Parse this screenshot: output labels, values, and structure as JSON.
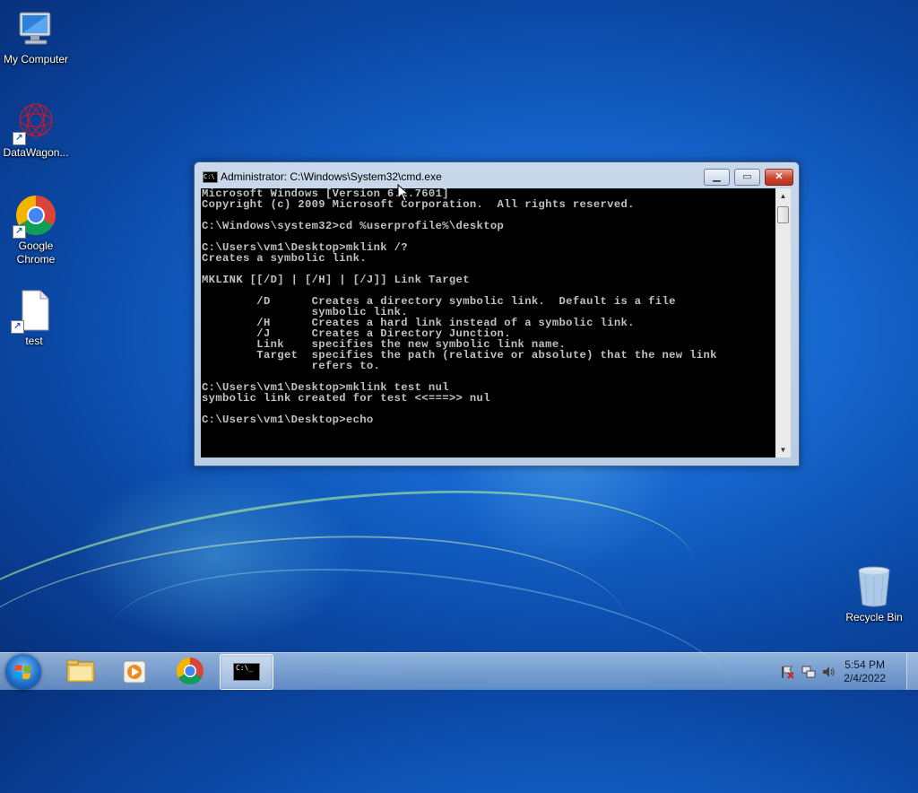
{
  "desktop": {
    "icons": [
      {
        "label": "My Computer",
        "icon": "computer-icon"
      },
      {
        "label": "DataWagon...",
        "icon": "datawagon-icon"
      },
      {
        "label": "Google Chrome",
        "icon": "chrome-icon"
      },
      {
        "label": "test",
        "icon": "file-icon"
      },
      {
        "label": "Recycle Bin",
        "icon": "recycle-bin-icon"
      }
    ]
  },
  "window": {
    "title": "Administrator: C:\\Windows\\System32\\cmd.exe",
    "icon_label": "C:\\",
    "buttons": {
      "minimize": "minimize-icon",
      "maximize": "maximize-icon",
      "close": "close-icon"
    }
  },
  "console": {
    "lines": "Microsoft Windows [Version 6.1.7601]\nCopyright (c) 2009 Microsoft Corporation.  All rights reserved.\n\nC:\\Windows\\system32>cd %userprofile%\\desktop\n\nC:\\Users\\vm1\\Desktop>mklink /?\nCreates a symbolic link.\n\nMKLINK [[/D] | [/H] | [/J]] Link Target\n\n        /D      Creates a directory symbolic link.  Default is a file\n                symbolic link.\n        /H      Creates a hard link instead of a symbolic link.\n        /J      Creates a Directory Junction.\n        Link    specifies the new symbolic link name.\n        Target  specifies the path (relative or absolute) that the new link\n                refers to.\n\nC:\\Users\\vm1\\Desktop>mklink test nul\nsymbolic link created for test <<===>> nul\n\nC:\\Users\\vm1\\Desktop>echo"
  },
  "taskbar": {
    "items": [
      "explorer-icon",
      "media-player-icon",
      "chrome-icon",
      "cmd-icon"
    ],
    "cmd_label": "C:\\_",
    "time": "5:54 PM",
    "date": "2/4/2022",
    "tray": [
      "action-center-flag-icon",
      "network-icon",
      "volume-icon"
    ]
  },
  "colors": {
    "console_bg": "#000000",
    "console_fg": "#c0c0c0",
    "close_red": "#c9452f"
  }
}
